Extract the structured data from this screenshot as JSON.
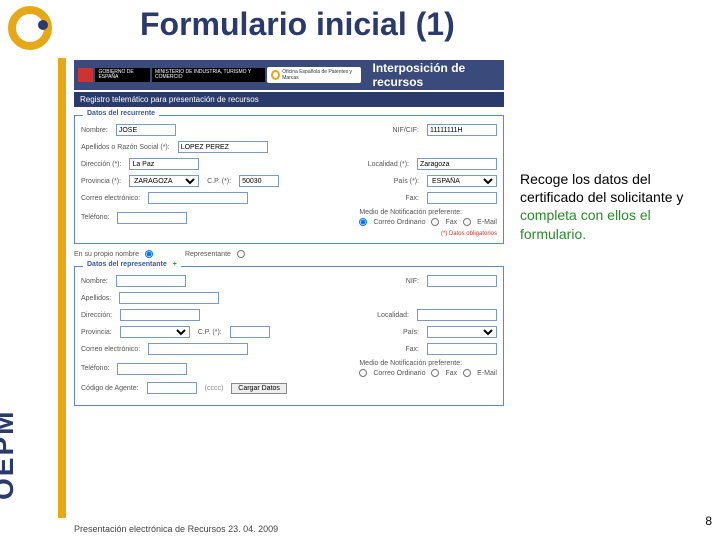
{
  "brand": {
    "sidebar": "OEPM"
  },
  "title": "Formulario inicial (1)",
  "banner": {
    "ministry1": "GOBIERNO DE ESPAÑA",
    "ministry2": "MINISTERIO DE INDUSTRIA, TURISMO Y COMERCIO",
    "office": "Oficina Española de Patentes y Marcas",
    "heading": "Interposición de recursos",
    "subheading": "Registro telemático para presentación de recursos"
  },
  "recurrente": {
    "legend": "Datos del recurrente",
    "nombre_label": "Nombre:",
    "nombre": "JOSE",
    "apellidos_label": "Apellidos o Razón Social (*):",
    "apellidos": "LOPEZ PEREZ",
    "nif_label": "NIF/CIF:",
    "nif": "11111111H",
    "direccion_label": "Dirección (*):",
    "direccion": "La Paz",
    "localidad_label": "Localidad (*):",
    "localidad": "Zaragoza",
    "provincia_label": "Provincia (*):",
    "provincia": "ZARAGOZA",
    "cp_label": "C.P. (*):",
    "cp": "50030",
    "pais_label": "País (*):",
    "pais": "ESPAÑA",
    "correo_label": "Correo electrónico:",
    "fax_label": "Fax:",
    "telefono_label": "Teléfono:",
    "medio_label": "Medio de Notificación preferente:",
    "medios": {
      "correo": "Correo Ordinario",
      "fax": "Fax",
      "email": "E-Mail"
    },
    "obl": "(*) Datos obligatorios"
  },
  "own": {
    "propio_label": "En su propio nombre",
    "repr_label": "Representante"
  },
  "representante": {
    "legend": "Datos del representante",
    "add": "+",
    "nombre_label": "Nombre:",
    "apellidos_label": "Apellidos:",
    "nif_label": "NIF:",
    "direccion_label": "Dirección:",
    "localidad_label": "Localidad:",
    "provincia_label": "Provincia:",
    "cp_label": "C.P. (*):",
    "pais_label": "País:",
    "correo_label": "Correo electrónico:",
    "fax_label": "Fax:",
    "telefono_label": "Teléfono:",
    "medio_label": "Medio de Notificación preferente:",
    "medios": {
      "correo": "Correo Ordinario",
      "fax": "Fax",
      "email": "E-Mail"
    },
    "codigo_label": "Código de Agente:",
    "codigo": "(cccc)",
    "btn": "Cargar Datos"
  },
  "annotation": {
    "line1": "Recoge los datos del certificado del solicitante y ",
    "line2": "completa con ellos el formulario."
  },
  "footer": "Presentación electrónica de Recursos 23. 04. 2009",
  "page": "8"
}
